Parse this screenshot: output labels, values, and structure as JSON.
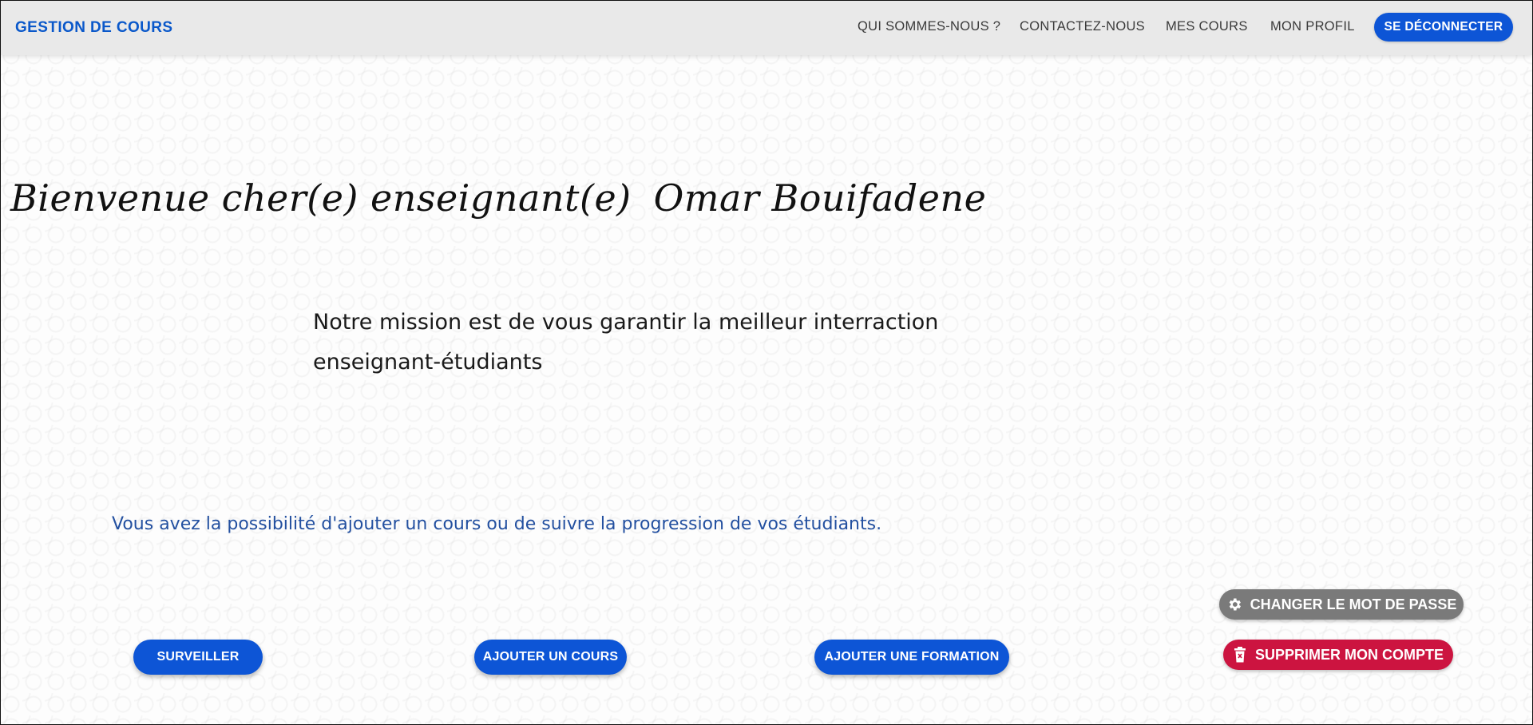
{
  "navbar": {
    "brand": "GESTION DE COURS",
    "links": [
      "QUI SOMMES-NOUS ?",
      "CONTACTEZ-NOUS",
      "MES COURS",
      "MON PROFIL"
    ],
    "logout_label": "SE DÉCONNECTER"
  },
  "hero": {
    "greeting": "Bienvenue cher(e) enseignant(e)",
    "teacher_name": "Omar Bouifadene",
    "mission": "Notre mission est de vous garantir la meilleur interraction enseignant-étudiants"
  },
  "info": {
    "possibility": "Vous avez la possibilité d'ajouter un cours ou de suivre la progression de vos étudiants."
  },
  "actions": {
    "surveiller": "SURVEILLER",
    "add_course": "AJOUTER UN COURS",
    "add_training": "AJOUTER UNE FORMATION"
  },
  "account": {
    "change_password": "CHANGER LE MOT DE PASSE",
    "change_password_icon": "gear-icon",
    "delete_account": "SUPPRIMER MON COMPTE",
    "delete_account_icon": "trash-icon"
  },
  "colors": {
    "brand_blue": "#0d55d6",
    "danger_red": "#cc1440",
    "neutral_gray": "#7a7a7a"
  }
}
